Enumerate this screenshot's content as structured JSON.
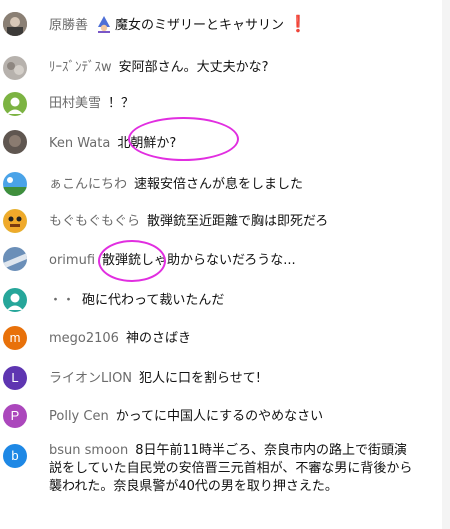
{
  "messages": [
    {
      "author": "原勝善",
      "text": "魔女のミザリーとキャサリン",
      "avatar_icon": "photo-avatar-icon",
      "has_wizard_emoji": true,
      "has_exclaim_emoji": true
    },
    {
      "author": "ﾘｰｽﾞﾝﾃﾞｽw",
      "text": "安阿部さん。大丈夫かな?",
      "avatar_icon": "photo-avatar-icon"
    },
    {
      "author": "田村美雪",
      "text": "！？",
      "avatar_icon": "default-person-avatar-icon"
    },
    {
      "author": "Ken Wata",
      "text": "北朝鮮か?",
      "avatar_icon": "photo-avatar-icon"
    },
    {
      "author": "ぁこんにちわ",
      "text": "速報安倍さんが息をしました",
      "avatar_icon": "photo-avatar-icon"
    },
    {
      "author": "もぐもぐもぐら",
      "text": "散弾銃至近距離で胸は即死だろ",
      "avatar_icon": "photo-avatar-icon"
    },
    {
      "author": "orimufi",
      "text": "散弾銃しゃ助からないだろうな...",
      "avatar_icon": "photo-avatar-icon"
    },
    {
      "author": "・・",
      "text": "砲に代わって裁いたんだ",
      "avatar_icon": "default-person-avatar-icon"
    },
    {
      "author": "mego2106",
      "text": "神のさばき",
      "avatar_letter": "m",
      "avatar_color": "#e8710a"
    },
    {
      "author": "ライオンLION",
      "text": "犯人に口を割らせて!",
      "avatar_letter": "L",
      "avatar_color": "#5e35b1"
    },
    {
      "author": "Polly Cen",
      "text": "かってに中国人にするのやめなさい",
      "avatar_letter": "P",
      "avatar_color": "#ab47bc"
    },
    {
      "author": "bsun smoon",
      "text": "8日午前11時半ごろ、奈良市内の路上で街頭演説をしていた自民党の安倍晋三元首相が、不審な男に背後から襲われた。奈良県警が40代の男を取り押さえた。",
      "avatar_letter": "b",
      "avatar_color": "#1e88e5"
    }
  ],
  "colors": {
    "annotation_circle": "#e12ee0",
    "author_text": "#6b6b6b",
    "message_text": "#111111"
  }
}
